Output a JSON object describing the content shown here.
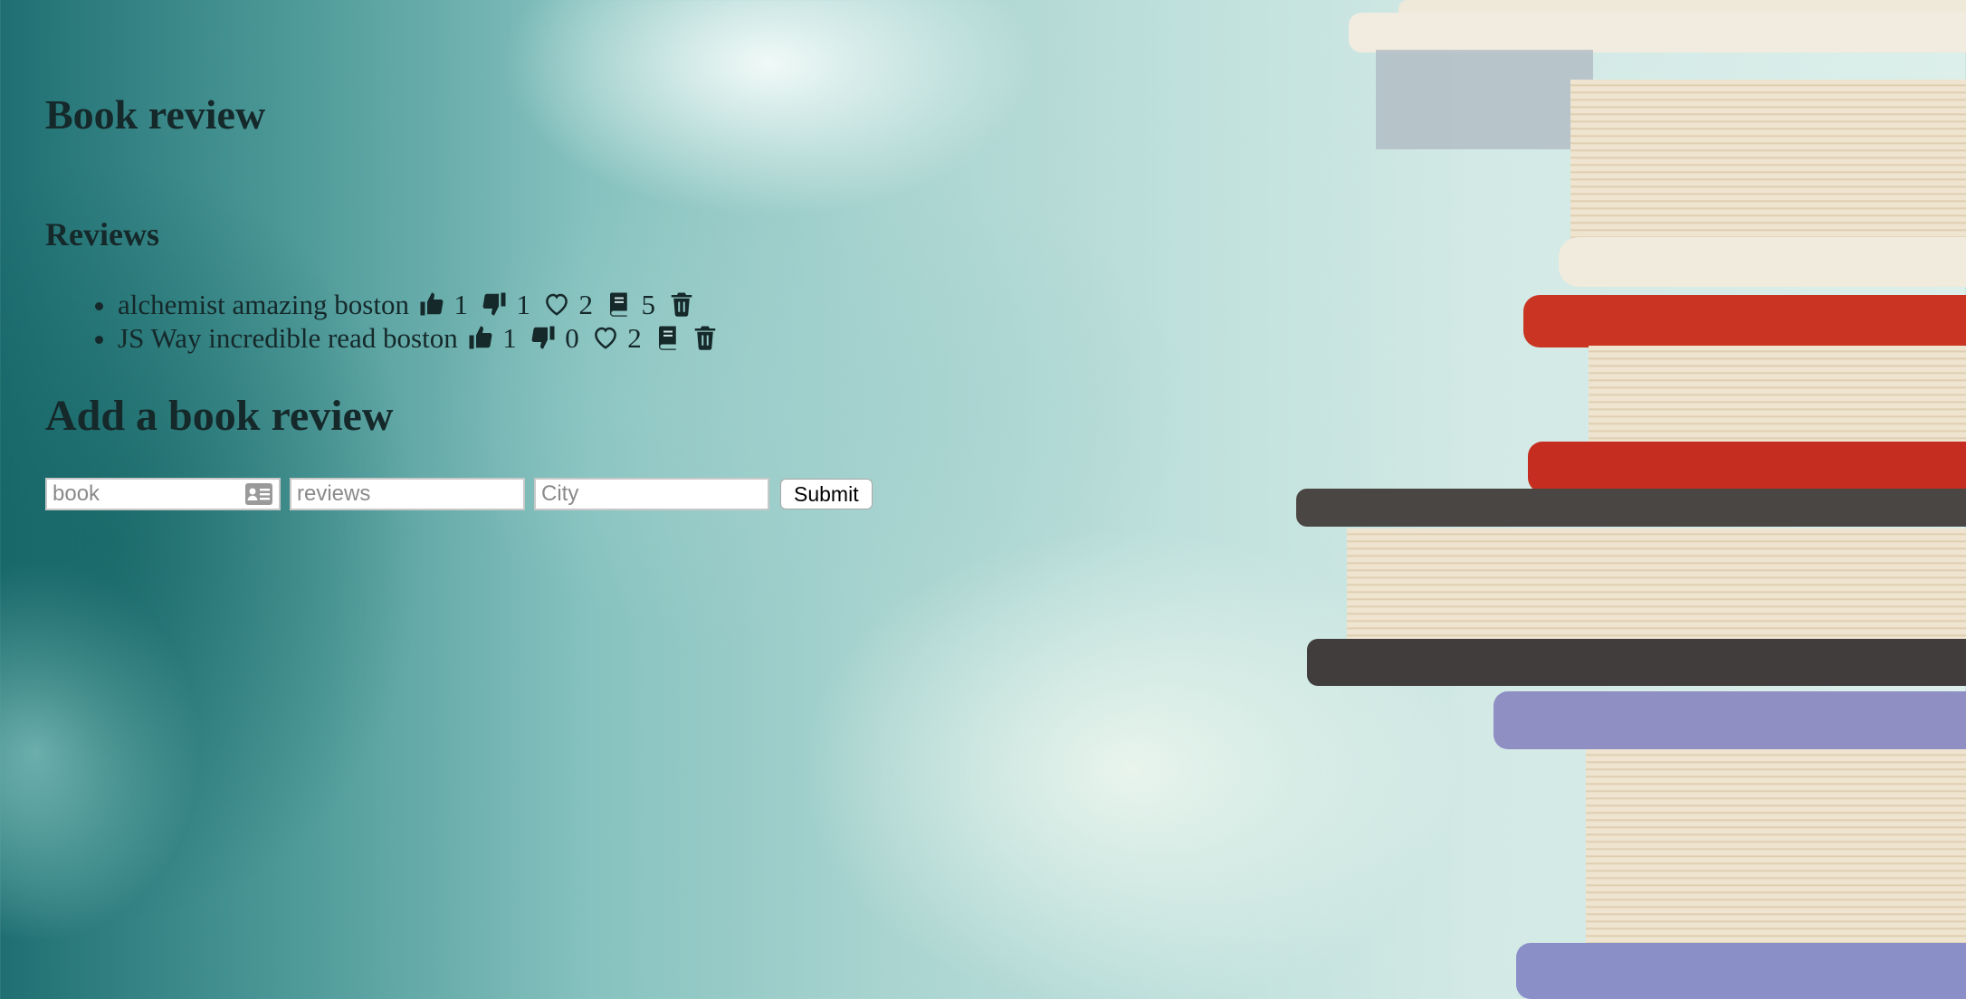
{
  "page": {
    "title": "Book review",
    "reviews_heading": "Reviews",
    "add_heading": "Add a book review"
  },
  "reviews": [
    {
      "text": "alchemist amazing boston",
      "thumbs_up": "1",
      "thumbs_down": "1",
      "hearts": "2",
      "books": "5"
    },
    {
      "text": "JS Way incredible read boston",
      "thumbs_up": "1",
      "thumbs_down": "0",
      "hearts": "2",
      "books": ""
    }
  ],
  "form": {
    "book_placeholder": "book",
    "reviews_placeholder": "reviews",
    "city_placeholder": "City",
    "submit_label": "Submit"
  },
  "icons": {
    "thumbs_up": "thumbs-up-icon",
    "thumbs_down": "thumbs-down-icon",
    "heart": "heart-icon",
    "book": "book-icon",
    "trash": "trash-icon",
    "contact_card": "contact-card-icon"
  }
}
